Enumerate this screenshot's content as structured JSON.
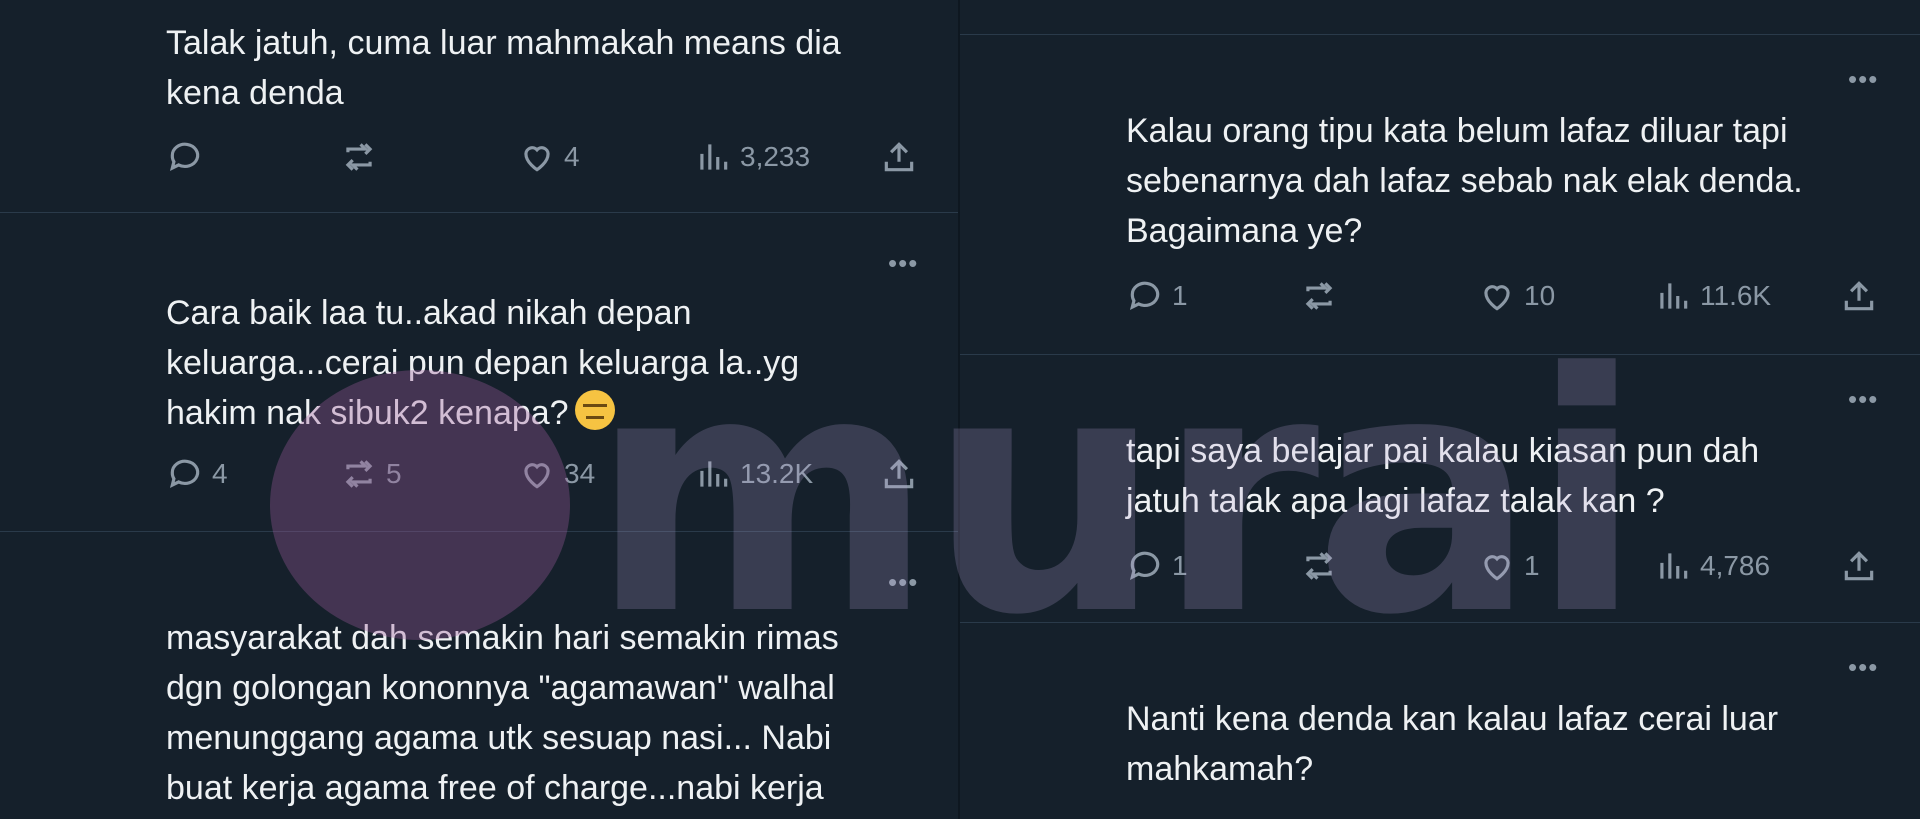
{
  "left_column": {
    "tweets": [
      {
        "lines": [
          "Talak jatuh, cuma luar mahmakah means dia",
          "kena denda"
        ],
        "reply": "",
        "retweet": "",
        "like": "4",
        "views": "3,233"
      },
      {
        "lines": [
          "Cara baik laa tu..akad nikah depan",
          "keluarga...cerai pun depan keluarga la..yg",
          "hakim nak sibuk2 kenapa?"
        ],
        "reply": "4",
        "retweet": "5",
        "like": "34",
        "views": "13.2K"
      },
      {
        "lines": [
          "masyarakat dah semakin hari semakin rimas",
          "dgn golongan kononnya \"agamawan\" walhal",
          "menunggang agama utk sesuap nasi... Nabi",
          "buat kerja agama free of charge...nabi kerja"
        ]
      }
    ]
  },
  "right_column": {
    "tweets": [
      {
        "lines": [
          "Kalau orang tipu kata belum lafaz diluar tapi",
          "sebenarnya dah lafaz sebab nak elak denda.",
          "Bagaimana ye?"
        ],
        "reply": "1",
        "retweet": "",
        "like": "10",
        "views": "11.6K"
      },
      {
        "lines": [
          "tapi saya belajar pai kalau kiasan pun dah",
          "jatuh talak apa lagi lafaz talak kan ?"
        ],
        "reply": "1",
        "retweet": "",
        "like": "1",
        "views": "4,786"
      },
      {
        "lines": [
          "Nanti kena denda kan kalau lafaz cerai luar",
          "mahkamah?"
        ]
      }
    ]
  },
  "more_label": "•••",
  "emoji_name": "expressionless-face-emoji",
  "watermark": {
    "text": "murai"
  },
  "colors": {
    "background": "#15202b",
    "text": "#e7e9ea",
    "muted": "#8b98a5"
  }
}
